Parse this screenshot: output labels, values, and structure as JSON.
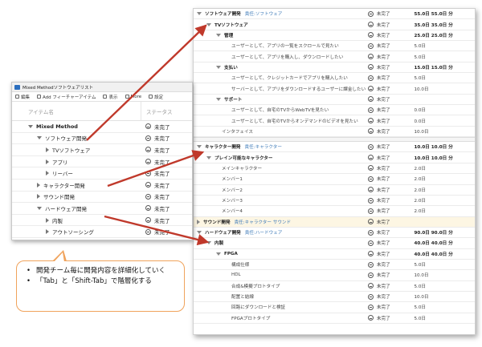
{
  "left_window": {
    "title": "Mixed Methodソフトウェアリスト",
    "toolbar": [
      {
        "label": "編集",
        "icon": "edit-icon"
      },
      {
        "label": "Add フィーチャーアイテム",
        "icon": "add-icon"
      },
      {
        "label": "表示",
        "icon": "view-icon"
      },
      {
        "label": "More",
        "icon": "more-icon"
      },
      {
        "label": "設定",
        "icon": "settings-icon"
      }
    ],
    "header": {
      "name": "アイテム名",
      "status": "ステータス"
    },
    "rows": [
      {
        "name": "Mixed Method",
        "status": "未完了",
        "indent": 0,
        "toggle": "down",
        "bold": true
      },
      {
        "name": "ソフトウェア開発",
        "status": "未完了",
        "indent": 1,
        "toggle": "down",
        "bold": false
      },
      {
        "name": "TVソフトウェア",
        "status": "未完了",
        "indent": 2,
        "toggle": "right",
        "bold": false
      },
      {
        "name": "アプリ",
        "status": "未完了",
        "indent": 2,
        "toggle": "right",
        "bold": false
      },
      {
        "name": "リーバー",
        "status": "未完了",
        "indent": 2,
        "toggle": "right",
        "bold": false
      },
      {
        "name": "キャラクター開発",
        "status": "未完了",
        "indent": 1,
        "toggle": "right",
        "bold": false
      },
      {
        "name": "サウンド開発",
        "status": "未完了",
        "indent": 1,
        "toggle": "right",
        "bold": false
      },
      {
        "name": "ハードウェア開発",
        "status": "未完了",
        "indent": 1,
        "toggle": "down",
        "bold": false
      },
      {
        "name": "内製",
        "status": "未完了",
        "indent": 2,
        "toggle": "right",
        "bold": false
      },
      {
        "name": "アウトソーシング",
        "status": "未完了",
        "indent": 2,
        "toggle": "right",
        "bold": false
      }
    ]
  },
  "right_window": {
    "sections": [
      {
        "rows": [
          {
            "name": "ソフトウェア開発",
            "tag": "責任:ソフトウェア",
            "status": "未完了",
            "duration": "55.0日  55.0日 分",
            "indent": 0,
            "toggle": "down",
            "bold": true
          },
          {
            "name": "TVソフトウェア",
            "tag": "",
            "status": "未完了",
            "duration": "35.0日  35.0日 分",
            "indent": 1,
            "toggle": "down",
            "bold": true
          },
          {
            "name": "管理",
            "tag": "",
            "status": "未完了",
            "duration": "25.0日  25.0日 分",
            "indent": 2,
            "toggle": "down",
            "bold": true
          },
          {
            "name": "ユーザーとして、アプリの一覧をスクロールで見たい",
            "tag": "",
            "status": "未完了",
            "duration": "5.0日",
            "indent": 3,
            "toggle": "",
            "bold": false
          },
          {
            "name": "ユーザーとして、アプリを購入し、ダウンロードしたい",
            "tag": "",
            "status": "未完了",
            "duration": "5.0日",
            "indent": 3,
            "toggle": "",
            "bold": false
          },
          {
            "name": "支払い",
            "tag": "",
            "status": "未完了",
            "duration": "15.0日  15.0日 分",
            "indent": 2,
            "toggle": "down",
            "bold": true
          },
          {
            "name": "ユーザーとして、クレジットカードでアプリを購入したい",
            "tag": "",
            "status": "未完了",
            "duration": "5.0日",
            "indent": 3,
            "toggle": "",
            "bold": false
          },
          {
            "name": "サーバーとして、アプリをダウンロードするユーザーに課金したい",
            "tag": "",
            "status": "未完了",
            "duration": "10.0日",
            "indent": 3,
            "toggle": "",
            "bold": false
          },
          {
            "name": "サポート",
            "tag": "",
            "status": "未完了",
            "duration": "",
            "indent": 2,
            "toggle": "down",
            "bold": true
          },
          {
            "name": "ユーザーとして、自宅のTVからWebTVを見たい",
            "tag": "",
            "status": "未完了",
            "duration": "0.0日",
            "indent": 3,
            "toggle": "",
            "bold": false
          },
          {
            "name": "ユーザーとして、自宅のTVからオンデマンドのビデオを見たい",
            "tag": "",
            "status": "未完了",
            "duration": "0.0日",
            "indent": 3,
            "toggle": "",
            "bold": false
          },
          {
            "name": "インタフェイス",
            "tag": "",
            "status": "未完了",
            "duration": "10.0日",
            "indent": 2,
            "toggle": "",
            "bold": false
          }
        ]
      },
      {
        "rows": [
          {
            "name": "キャラクター開発",
            "tag": "責任:キャラクター",
            "status": "未完了",
            "duration": "10.0日  10.0日 分",
            "indent": 0,
            "toggle": "down",
            "bold": true,
            "highlight": false
          },
          {
            "name": "プレイン可能なキャラクター",
            "tag": "",
            "status": "未完了",
            "duration": "10.0日  10.0日 分",
            "indent": 1,
            "toggle": "down",
            "bold": true,
            "highlight": false
          },
          {
            "name": "メインキャラクター",
            "tag": "",
            "status": "未完了",
            "duration": "2.0日",
            "indent": 2,
            "toggle": "",
            "bold": false,
            "highlight": false
          },
          {
            "name": "メンバー1",
            "tag": "",
            "status": "未完了",
            "duration": "2.0日",
            "indent": 2,
            "toggle": "",
            "bold": false,
            "highlight": false
          },
          {
            "name": "メンバー2",
            "tag": "",
            "status": "未完了",
            "duration": "2.0日",
            "indent": 2,
            "toggle": "",
            "bold": false,
            "highlight": false
          },
          {
            "name": "メンバー3",
            "tag": "",
            "status": "未完了",
            "duration": "2.0日",
            "indent": 2,
            "toggle": "",
            "bold": false,
            "highlight": false
          },
          {
            "name": "メンバー4",
            "tag": "",
            "status": "未完了",
            "duration": "2.0日",
            "indent": 2,
            "toggle": "",
            "bold": false,
            "highlight": false
          },
          {
            "name": "サウンド開発",
            "tag": "責任:キャラクター サウンド",
            "status": "未完了",
            "duration": "",
            "indent": 0,
            "toggle": "right",
            "bold": true,
            "highlight": true
          },
          {
            "name": "ハードウェア開発",
            "tag": "責任:ハードウェア",
            "status": "未完了",
            "duration": "90.0日  90.0日 分",
            "indent": 0,
            "toggle": "down",
            "bold": true,
            "highlight": false
          },
          {
            "name": "内製",
            "tag": "",
            "status": "未完了",
            "duration": "40.0日  40.0日 分",
            "indent": 1,
            "toggle": "down",
            "bold": true,
            "highlight": false
          },
          {
            "name": "FPGA",
            "tag": "",
            "status": "未完了",
            "duration": "40.0日  40.0日 分",
            "indent": 2,
            "toggle": "down",
            "bold": true,
            "highlight": false
          },
          {
            "name": "構成仕様",
            "tag": "",
            "status": "未完了",
            "duration": "5.0日",
            "indent": 3,
            "toggle": "",
            "bold": false,
            "highlight": false
          },
          {
            "name": "HDL",
            "tag": "",
            "status": "未完了",
            "duration": "10.0日",
            "indent": 3,
            "toggle": "",
            "bold": false,
            "highlight": false
          },
          {
            "name": "合成&模擬プロトタイプ",
            "tag": "",
            "status": "未完了",
            "duration": "5.0日",
            "indent": 3,
            "toggle": "",
            "bold": false,
            "highlight": false
          },
          {
            "name": "配置と結線",
            "tag": "",
            "status": "未完了",
            "duration": "10.0日",
            "indent": 3,
            "toggle": "",
            "bold": false,
            "highlight": false
          },
          {
            "name": "回路にダウンロードと検証",
            "tag": "",
            "status": "未完了",
            "duration": "5.0日",
            "indent": 3,
            "toggle": "",
            "bold": false,
            "highlight": false
          },
          {
            "name": "FPGAプロトタイプ",
            "tag": "",
            "status": "未完了",
            "duration": "5.0日",
            "indent": 3,
            "toggle": "",
            "bold": false,
            "highlight": false
          }
        ]
      }
    ]
  },
  "callout": {
    "lines": [
      "開発チーム毎に開発内容を詳細化していく",
      "「Tab」と「Shift-Tab」で階層化する"
    ]
  },
  "colors": {
    "arrow": "#c0392b",
    "callout_border": "#f0a35c",
    "tag": "#3d7ab8"
  }
}
